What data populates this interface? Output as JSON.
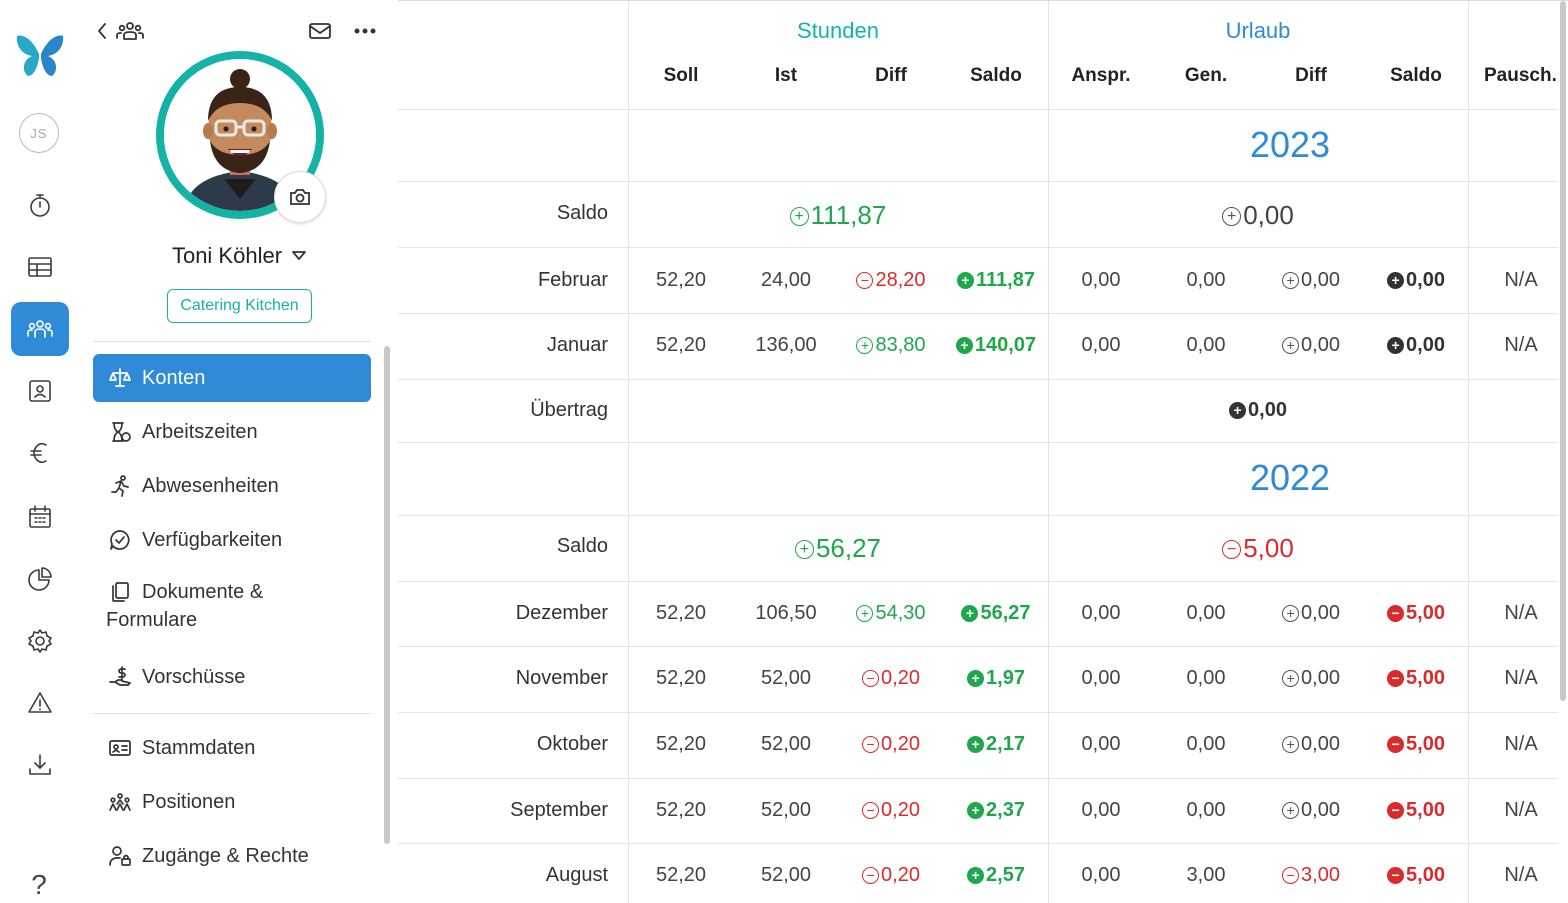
{
  "user": {
    "initials": "JS"
  },
  "profile": {
    "name": "Toni Köhler",
    "department": "Catering Kitchen"
  },
  "menu": {
    "items": [
      {
        "label": "Konten",
        "icon": "scale-icon",
        "active": true
      },
      {
        "label": "Arbeitszeiten",
        "icon": "hourglass-icon"
      },
      {
        "label": "Abwesenheiten",
        "icon": "running-person-icon"
      },
      {
        "label": "Verfügbarkeiten",
        "icon": "check-bubble-icon"
      },
      {
        "label_line1": "Dokumente &",
        "label_line2": "Formulare",
        "icon": "documents-icon"
      },
      {
        "label": "Vorschüsse",
        "icon": "hand-money-icon"
      },
      {
        "label": "Stammdaten",
        "icon": "id-card-icon"
      },
      {
        "label": "Positionen",
        "icon": "team-positions-icon"
      },
      {
        "label": "Zugänge & Rechte",
        "icon": "user-lock-icon"
      }
    ]
  },
  "table": {
    "groups": {
      "stunden": "Stunden",
      "urlaub": "Urlaub"
    },
    "headers": [
      "Soll",
      "Ist",
      "Diff",
      "Saldo",
      "Anspr.",
      "Gen.",
      "Diff",
      "Saldo",
      "Pausch."
    ],
    "years": [
      {
        "year": "2023",
        "saldo_label": "Saldo",
        "saldo_stunden": "111,87",
        "saldo_urlaub": "0,00",
        "rows": [
          {
            "month": "Februar",
            "soll": "52,20",
            "ist": "24,00",
            "diff": "28,20",
            "saldo": "111,87",
            "anspr": "0,00",
            "gen": "0,00",
            "udiff": "0,00",
            "usaldo": "0,00",
            "pausch": "N/A"
          },
          {
            "month": "Januar",
            "soll": "52,20",
            "ist": "136,00",
            "diff": "83,80",
            "saldo": "140,07",
            "anspr": "0,00",
            "gen": "0,00",
            "udiff": "0,00",
            "usaldo": "0,00",
            "pausch": "N/A"
          }
        ],
        "uebertrag_label": "Übertrag",
        "uebertrag_value": "0,00"
      },
      {
        "year": "2022",
        "saldo_label": "Saldo",
        "saldo_stunden": "56,27",
        "saldo_urlaub": "5,00",
        "rows": [
          {
            "month": "Dezember",
            "soll": "52,20",
            "ist": "106,50",
            "diff": "54,30",
            "saldo": "56,27",
            "anspr": "0,00",
            "gen": "0,00",
            "udiff": "0,00",
            "usaldo": "5,00",
            "pausch": "N/A"
          },
          {
            "month": "November",
            "soll": "52,20",
            "ist": "52,00",
            "diff": "0,20",
            "saldo": "1,97",
            "anspr": "0,00",
            "gen": "0,00",
            "udiff": "0,00",
            "usaldo": "5,00",
            "pausch": "N/A"
          },
          {
            "month": "Oktober",
            "soll": "52,20",
            "ist": "52,00",
            "diff": "0,20",
            "saldo": "2,17",
            "anspr": "0,00",
            "gen": "0,00",
            "udiff": "0,00",
            "usaldo": "5,00",
            "pausch": "N/A"
          },
          {
            "month": "September",
            "soll": "52,20",
            "ist": "52,00",
            "diff": "0,20",
            "saldo": "2,37",
            "anspr": "0,00",
            "gen": "0,00",
            "udiff": "0,00",
            "usaldo": "5,00",
            "pausch": "N/A"
          },
          {
            "month": "August",
            "soll": "52,20",
            "ist": "52,00",
            "diff": "0,20",
            "saldo": "2,57",
            "anspr": "0,00",
            "gen": "3,00",
            "udiff": "3,00",
            "usaldo": "5,00",
            "pausch": "N/A"
          }
        ]
      }
    ]
  },
  "colors": {
    "accent_blue": "#2f8bd8",
    "teal": "#15b3a6",
    "positive": "#1ea84b",
    "negative": "#d92b2b"
  }
}
